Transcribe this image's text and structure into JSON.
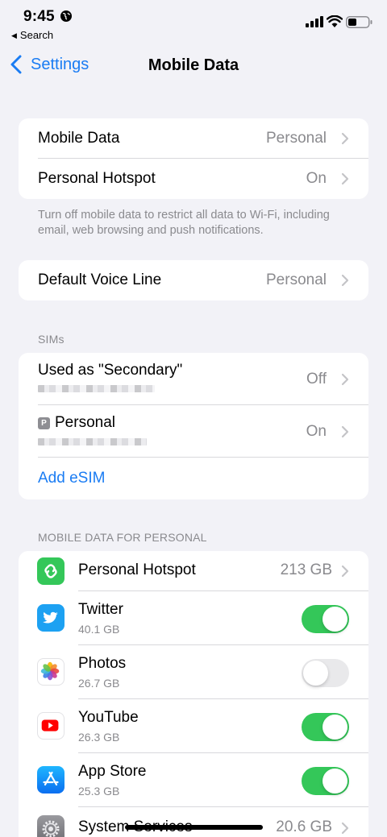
{
  "status": {
    "time": "9:45",
    "back_app": "Search"
  },
  "nav": {
    "back_label": "Settings",
    "title": "Mobile Data"
  },
  "group1": {
    "mobile_data_label": "Mobile Data",
    "mobile_data_value": "Personal",
    "hotspot_label": "Personal Hotspot",
    "hotspot_value": "On"
  },
  "footnote": "Turn off mobile data to restrict all data to Wi-Fi, including email, web browsing and push notifications.",
  "voice": {
    "label": "Default Voice Line",
    "value": "Personal"
  },
  "sims": {
    "header": "SIMs",
    "secondary_label": "Used as \"Secondary\"",
    "secondary_value": "Off",
    "personal_badge": "P",
    "personal_label": "Personal",
    "personal_value": "On",
    "add_esim": "Add eSIM"
  },
  "usage": {
    "header": "MOBILE DATA FOR PERSONAL",
    "apps": [
      {
        "name": "Personal Hotspot",
        "usage": "213 GB",
        "icon": "hotspot-icon"
      },
      {
        "name": "Twitter",
        "usage": "40.1 GB",
        "enabled": true,
        "icon": "twitter-icon"
      },
      {
        "name": "Photos",
        "usage": "26.7 GB",
        "enabled": false,
        "icon": "photos-icon"
      },
      {
        "name": "YouTube",
        "usage": "26.3 GB",
        "enabled": true,
        "icon": "youtube-icon"
      },
      {
        "name": "App Store",
        "usage": "25.3 GB",
        "enabled": true,
        "icon": "app-store-icon"
      },
      {
        "name": "System Services",
        "usage": "20.6 GB",
        "icon": "gear-icon"
      }
    ]
  },
  "colors": {
    "accent": "#1a7cf3",
    "toggle_on": "#34c759",
    "background": "#f2f2f7"
  }
}
